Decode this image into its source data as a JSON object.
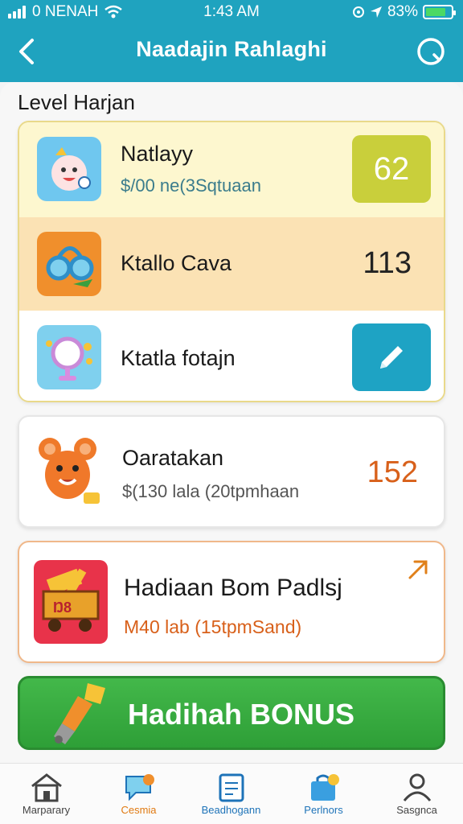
{
  "status_bar": {
    "carrier": "0 NENAH",
    "time": "1:43 AM",
    "battery": "83%"
  },
  "header": {
    "title": "Naadajin Rahlaghi"
  },
  "section_title": "Level Harjan",
  "group_rows": [
    {
      "name": "Natlayy",
      "sub": "$/00 ne(3Sqtuaan",
      "value": "62"
    },
    {
      "name": "Ktallo Cava",
      "value": "113"
    },
    {
      "name": "Ktatla fotajn"
    }
  ],
  "card_a": {
    "name": "Oaratakan",
    "sub": "$(130 lala (20tpmhaan",
    "value": "152"
  },
  "card_b": {
    "name": "Hadiaan Bom Padlsj",
    "sub": "M40 lab (15tpmSand)"
  },
  "bonus_button": {
    "label": "Hadihah BONUS"
  },
  "bottom_nav": [
    {
      "label": "Marparary",
      "icon": "home-icon",
      "color": "#444444"
    },
    {
      "label": "Cesmia",
      "icon": "chat-icon",
      "color": "#e07a12"
    },
    {
      "label": "Beadhogann",
      "icon": "notes-icon",
      "color": "#1e73b8"
    },
    {
      "label": "Perlnors",
      "icon": "bag-icon",
      "color": "#1e73b8"
    },
    {
      "label": "Sasgnca",
      "icon": "person-icon",
      "color": "#444444"
    }
  ],
  "colors": {
    "header": "#1fa3bf",
    "bonus": "#3aad41",
    "edit": "#1ea3c4",
    "score_box": "#c9cf3b"
  }
}
